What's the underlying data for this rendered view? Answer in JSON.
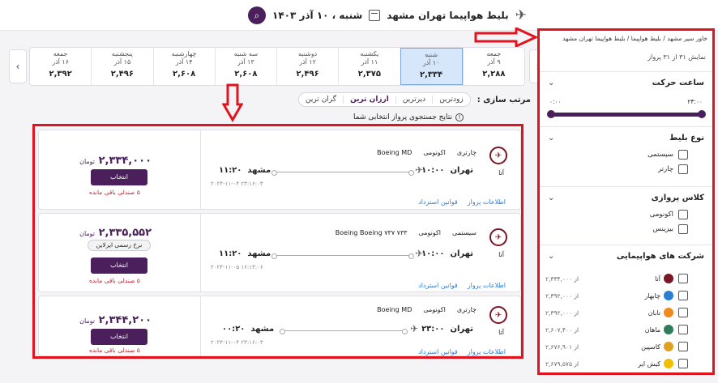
{
  "header": {
    "route_title": "بلیط هواپیما تهران مشهد",
    "date": "شنبه ، ۱۰ آذر ۱۴۰۳"
  },
  "date_strip": [
    {
      "day": "جمعه",
      "date": "۹ آذر",
      "price": "۲,۲۸۸",
      "active": false
    },
    {
      "day": "شنبه",
      "date": "۱۰ آذر",
      "price": "۲,۳۳۴",
      "active": true
    },
    {
      "day": "یکشنبه",
      "date": "۱۱ آذر",
      "price": "۲,۳۷۵",
      "active": false
    },
    {
      "day": "دوشنبه",
      "date": "۱۲ آذر",
      "price": "۲,۴۹۶",
      "active": false
    },
    {
      "day": "سه شنبه",
      "date": "۱۳ آذر",
      "price": "۲,۶۰۸",
      "active": false
    },
    {
      "day": "چهارشنبه",
      "date": "۱۴ آذر",
      "price": "۲,۶۰۸",
      "active": false
    },
    {
      "day": "پنجشنبه",
      "date": "۱۵ آذر",
      "price": "۲,۴۹۶",
      "active": false
    },
    {
      "day": "جمعه",
      "date": "۱۶ آذر",
      "price": "۲,۳۹۲",
      "active": false
    }
  ],
  "sort": {
    "label": "مرتب سازی :",
    "options": [
      "زودترین",
      "دیرترین",
      "ارزان ترین",
      "گران ترین"
    ],
    "active": "ارزان ترین"
  },
  "info_text": "نتایج جستجوی پرواز انتخابی شما",
  "flights": [
    {
      "airline": "آتا",
      "type": "چارتری",
      "class": "اکونومی",
      "aircraft": "Boeing MD",
      "origin": "تهران",
      "dep_time": "۱۰:۰۰",
      "destination": "مشهد",
      "arr_time": "۱۱:۲۰",
      "stamp": "۲۰۲۴-۱۱-۰۴ ۲۳:۱۶:۰۳",
      "price": "۲,۳۳۴,۰۰۰",
      "currency": "تومان",
      "official": "",
      "select": "انتخاب",
      "seats": "۵ صندلی باقی مانده",
      "link_info": "اطلاعات پرواز",
      "link_refund": "قوانین استرداد"
    },
    {
      "airline": "آتا",
      "type": "سیستمی",
      "class": "اکونومی",
      "aircraft": "Boeing Boeing ۷۳۷ ۷۳۳",
      "origin": "تهران",
      "dep_time": "۱۰:۰۰",
      "destination": "مشهد",
      "arr_time": "۱۱:۲۰",
      "stamp": "۲۰۲۴-۱۱-۰۵ ۱۶:۱۳:۰۶",
      "price": "۲,۳۳۵,۵۵۲",
      "currency": "تومان",
      "official": "نرخ رسمی ایرلاین",
      "select": "انتخاب",
      "seats": "۵ صندلی باقی مانده",
      "link_info": "اطلاعات پرواز",
      "link_refund": "قوانین استرداد"
    },
    {
      "airline": "آتا",
      "type": "چارتری",
      "class": "اکونومی",
      "aircraft": "Boeing MD",
      "origin": "تهران",
      "dep_time": "۲۳:۰۰",
      "destination": "مشهد",
      "arr_time": "۰۰:۲۰",
      "stamp": "۲۰۲۴-۱۱-۰۴ ۲۳:۱۶:۰۳",
      "price": "۲,۳۴۴,۲۰۰",
      "currency": "تومان",
      "official": "",
      "select": "انتخاب",
      "seats": "۵ صندلی باقی مانده",
      "link_info": "اطلاعات پرواز",
      "link_refund": "قوانین استرداد"
    }
  ],
  "sidebar": {
    "breadcrumb": "خاور سیر مشهد / بلیط هواپیما / بلیط هواپیما تهران مشهد",
    "showing": "نمایش ۳۱ از ۳۱ پرواز",
    "departure": {
      "title": "ساعت حرکت",
      "min": "۰:۰۰",
      "max": "۲۴:۰۰"
    },
    "ticket_type": {
      "title": "نوع بلیط",
      "items": [
        "سیستمی",
        "چارتر"
      ]
    },
    "flight_class": {
      "title": "کلاس پروازی",
      "items": [
        "اکونومی",
        "بیزینس"
      ]
    },
    "airlines": {
      "title": "شرکت های هواپیمایی",
      "items": [
        {
          "name": "آتا",
          "from": "از ۲,۳۳۴,۰۰۰",
          "color": "#7a1724"
        },
        {
          "name": "چابهار",
          "from": "از ۲,۳۹۲,۰۰۰",
          "color": "#2a7fd0"
        },
        {
          "name": "تابان",
          "from": "از ۲,۳۹۲,۰۰۰",
          "color": "#f08a1c"
        },
        {
          "name": "ماهان",
          "from": "از ۲,۶۰۷,۴۰۰",
          "color": "#2d7d5a"
        },
        {
          "name": "کاسپین",
          "from": "از ۲,۶۷۶,۹۰۱",
          "color": "#e0a020"
        },
        {
          "name": "کیش ایر",
          "from": "از ۲,۶۷۹,۵۷۵",
          "color": "#f0c000"
        }
      ]
    }
  },
  "colors": {
    "brand": "#4a1f5c",
    "highlight": "#e0141e",
    "link": "#2e7bd1",
    "active_date": "#d6e7fb"
  }
}
